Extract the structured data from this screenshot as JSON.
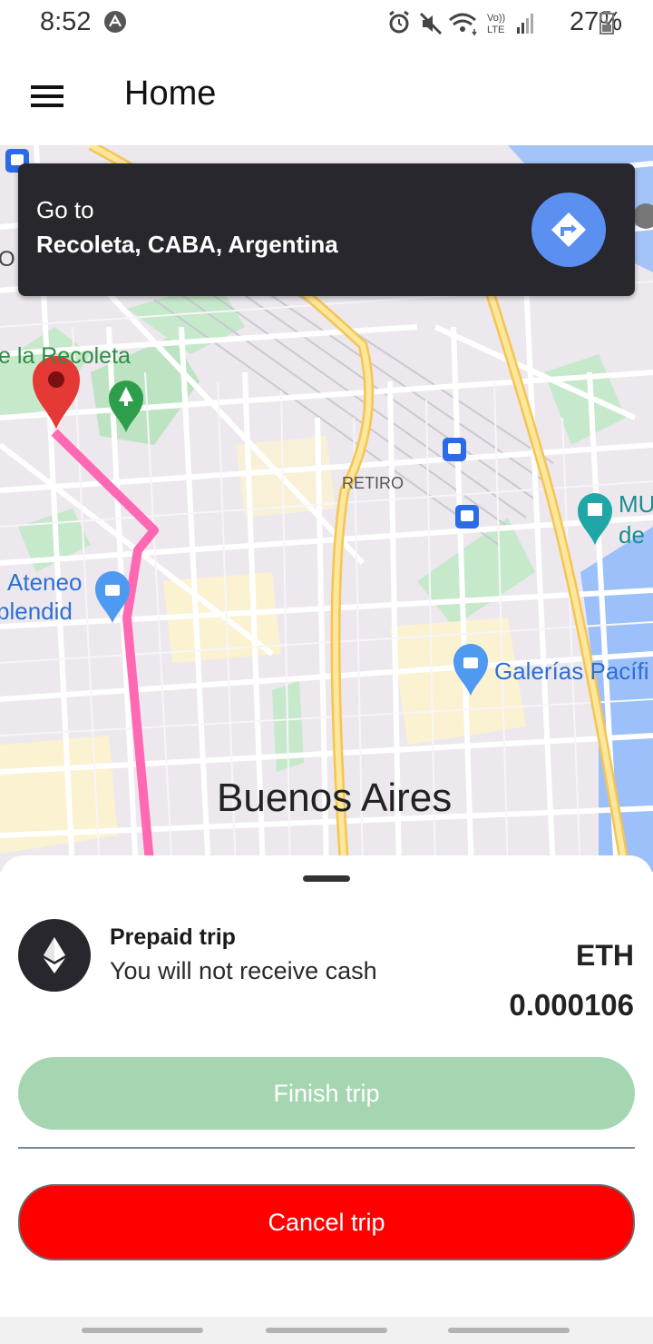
{
  "status_bar": {
    "time": "8:52",
    "battery": "27%",
    "icons": [
      "app-notification-icon",
      "alarm-icon",
      "mute-icon",
      "wifi-icon",
      "volte-icon",
      "signal-icon",
      "battery-icon"
    ]
  },
  "app_bar": {
    "title": "Home",
    "menu_icon": "hamburger-menu-icon"
  },
  "map": {
    "labels": {
      "recoleta": "e la Recoleta",
      "retiro": "RETIRO",
      "ateneo_1": "Ateneo",
      "ateneo_2": "plendid",
      "galerias": "Galerías Pacífi",
      "museum_1": "MU",
      "museum_2": "de",
      "city": "Buenos Aires",
      "edge_o": "O"
    },
    "route_color": "#ff69b4",
    "pin_color": "#e53935"
  },
  "goto_card": {
    "prefix": "Go to",
    "destination": "Recoleta, CABA, Argentina",
    "nav_icon": "directions-icon"
  },
  "trip": {
    "title": "Prepaid trip",
    "subtitle": "You will not receive cash",
    "currency": "ETH",
    "amount": "0.000106",
    "icon": "ethereum-icon"
  },
  "actions": {
    "finish_label": "Finish trip",
    "cancel_label": "Cancel trip"
  },
  "colors": {
    "finish": "#a6d6b1",
    "cancel": "#ff0000",
    "card": "#28272e",
    "accent": "#5b8ff0"
  }
}
